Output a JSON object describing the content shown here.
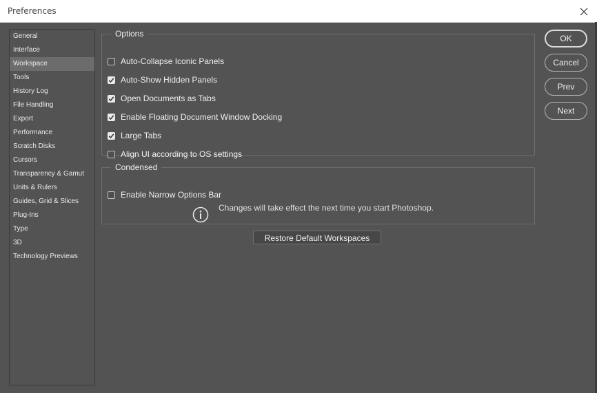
{
  "window": {
    "title": "Preferences",
    "close_icon": "close-icon"
  },
  "sidebar": {
    "active_index": 2,
    "items": [
      {
        "label": "General"
      },
      {
        "label": "Interface"
      },
      {
        "label": "Workspace"
      },
      {
        "label": "Tools"
      },
      {
        "label": "History Log"
      },
      {
        "label": "File Handling"
      },
      {
        "label": "Export"
      },
      {
        "label": "Performance"
      },
      {
        "label": "Scratch Disks"
      },
      {
        "label": "Cursors"
      },
      {
        "label": "Transparency & Gamut"
      },
      {
        "label": "Units & Rulers"
      },
      {
        "label": "Guides, Grid & Slices"
      },
      {
        "label": "Plug-Ins"
      },
      {
        "label": "Type"
      },
      {
        "label": "3D"
      },
      {
        "label": "Technology Previews"
      }
    ]
  },
  "options": {
    "legend": "Options",
    "items": [
      {
        "label": "Auto-Collapse Iconic Panels",
        "checked": false
      },
      {
        "label": "Auto-Show Hidden Panels",
        "checked": true
      },
      {
        "label": "Open Documents as Tabs",
        "checked": true
      },
      {
        "label": "Enable Floating Document Window Docking",
        "checked": true
      },
      {
        "label": "Large Tabs",
        "checked": true
      },
      {
        "label": "Align UI according to OS settings",
        "checked": false
      }
    ]
  },
  "condensed": {
    "legend": "Condensed",
    "items": [
      {
        "label": "Enable Narrow Options Bar",
        "checked": false
      }
    ],
    "info_icon": "info-icon",
    "info_text": "Changes will take effect the next time you start Photoshop."
  },
  "restore_button": "Restore Default Workspaces",
  "buttons": {
    "ok": "OK",
    "cancel": "Cancel",
    "prev": "Prev",
    "next": "Next"
  },
  "colors": {
    "background": "#535353",
    "active_item": "#6c6c6c",
    "border": "#6e6e6e",
    "text": "#f0f0f0"
  }
}
